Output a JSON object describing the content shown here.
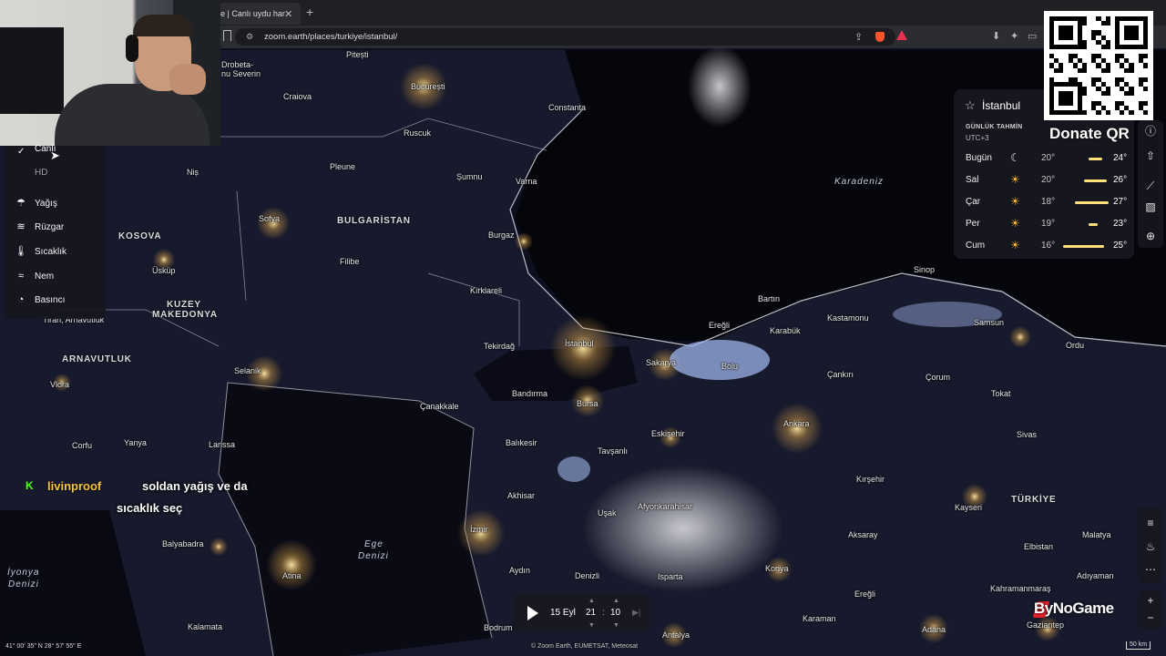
{
  "browser": {
    "tab_title": "e | Canlı uydu har",
    "url": "zoom.earth/places/turkiye/istanbul/"
  },
  "layer_menu": {
    "options": [
      "Canlı",
      "HD"
    ],
    "items": [
      {
        "label": "Yağış",
        "icon": "cloud-rain-icon"
      },
      {
        "label": "Rüzgar",
        "icon": "wind-icon"
      },
      {
        "label": "Sıcaklık",
        "icon": "thermometer-icon"
      },
      {
        "label": "Nem",
        "icon": "humidity-icon"
      },
      {
        "label": "Basıncı",
        "icon": "gauge-icon"
      }
    ]
  },
  "chat": {
    "username": "livinproof",
    "message_line1": "soldan yağış ve da",
    "message_line2": "sıcaklık seç"
  },
  "forecast": {
    "city": "İstanbul",
    "label": "GÜNLÜK TAHMİN",
    "timezone": "UTC+3",
    "days": [
      {
        "day": "Bugün",
        "icon": "moon-icon",
        "low": "20°",
        "high": "24°",
        "bar": [
          0.55,
          0.85
        ]
      },
      {
        "day": "Sal",
        "icon": "sun-icon",
        "low": "20°",
        "high": "26°",
        "bar": [
          0.45,
          0.95
        ]
      },
      {
        "day": "Çar",
        "icon": "sun-icon",
        "low": "18°",
        "high": "27°",
        "bar": [
          0.25,
          1.0
        ]
      },
      {
        "day": "Per",
        "icon": "sun-icon",
        "low": "19°",
        "high": "23°",
        "bar": [
          0.55,
          0.75
        ]
      },
      {
        "day": "Cum",
        "icon": "sun-icon",
        "low": "16°",
        "high": "25°",
        "bar": [
          0.0,
          0.9
        ]
      }
    ]
  },
  "donate": "Donate QR",
  "timeline": {
    "date": "15 Eyl",
    "hour": "21",
    "separator": ":",
    "minute": "10"
  },
  "footer": {
    "coords": "41° 00′ 35″ N   28° 57′ 55″ E",
    "attribution": "© Zoom Earth, EUMETSAT, Meteosat",
    "scale": "50 km"
  },
  "watermark": "ByNoGame",
  "map_labels": {
    "countries": [
      "BULGARİSTAN",
      "KOSOVA",
      "KUZEY",
      "MAKEDONYA",
      "ARNAVUTLUK",
      "TÜRKİYE"
    ],
    "seas": [
      "Karadeniz",
      "Ege",
      "Denizi",
      "İyonya",
      "Denizi"
    ],
    "cities": [
      "Drobeta-",
      "nu Severin",
      "Pitești",
      "Craiova",
      "București",
      "Constanța",
      "Ruscuk",
      "Niș",
      "Pleune",
      "Șumnu",
      "Varna",
      "Burgaz",
      "Sofya",
      "Filibe",
      "Üsküp",
      "Kırklareli",
      "Tiran, Arnavutluk",
      "Vlora",
      "Selanik",
      "Tekirdağ",
      "İstanbul",
      "Sakarya",
      "Bolu",
      "Karabük",
      "Ereğli",
      "Bartın",
      "Kastamonu",
      "Sinop",
      "Samsun",
      "Ordu",
      "Çankırı",
      "Çorum",
      "Tokat",
      "Bandırma",
      "Bursa",
      "Çanakkale",
      "Eskişehir",
      "Ankara",
      "Sivas",
      "Larissa",
      "Yanya",
      "Corfu",
      "Balıkesir",
      "Tavşanlı",
      "Akhisar",
      "Afyonkarahisar",
      "Uşak",
      "Kırşehir",
      "Kayseri",
      "Malatya",
      "Balyabadra",
      "Atina",
      "İzmir",
      "Aydın",
      "Denizli",
      "Isparta",
      "Konya",
      "Aksaray",
      "Elbistan",
      "Kahramanmaraş",
      "Adıyaman",
      "Kalamata",
      "Bodrum",
      "Antalya",
      "Karaman",
      "Ereğli",
      "Adana",
      "Gaziantep"
    ]
  }
}
